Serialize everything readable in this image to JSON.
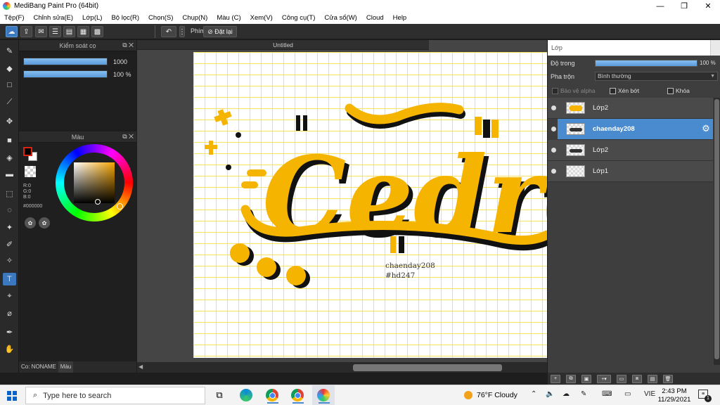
{
  "window": {
    "title": "MediBang Paint Pro (64bit)",
    "controls": {
      "minimize": "—",
      "maximize": "❐",
      "close": "✕"
    }
  },
  "menu": {
    "items": [
      "Tệp(F)",
      "Chỉnh sửa(E)",
      "Lớp(L)",
      "Bộ lọc(R)",
      "Chọn(S)",
      "Chụp(N)",
      "Màu (C)",
      "Xem(V)",
      "Công cụ(T)",
      "Cửa sổ(W)",
      "Cloud",
      "Help"
    ]
  },
  "toolbar": {
    "phim_label": "Phím",
    "reset_label": "Đặt lại"
  },
  "brush_panel": {
    "title": "Kiểm soát cọ",
    "size_value": "1000",
    "opacity_value": "100 %"
  },
  "color_panel": {
    "title": "Màu",
    "r": "R:0",
    "g": "G:0",
    "b": "B:0",
    "hex": "#000000",
    "accent": "#f5a400"
  },
  "bottom_tabs": {
    "brush_tab": "Co: NONAME",
    "color_tab": "Màu"
  },
  "canvas": {
    "doc_title": "Untitled",
    "signature_line1": "chaenday208",
    "signature_line2": "#hd247",
    "artwork_text": "Cedro"
  },
  "layer_panel": {
    "title": "Lớp",
    "opacity_label": "Độ trong",
    "opacity_value": "100 %",
    "blend_label": "Pha trộn",
    "blend_value": "Bình thường",
    "protect_alpha": "Bảo vệ alpha",
    "clipping": "Xén bớt",
    "lock": "Khóa",
    "layers": [
      {
        "name": "Lớp2",
        "selected": false
      },
      {
        "name": "chaenday208",
        "selected": true
      },
      {
        "name": "Lớp2",
        "selected": false
      },
      {
        "name": "Lớp1",
        "selected": false
      }
    ]
  },
  "taskbar": {
    "search_placeholder": "Type here to search",
    "weather_temp": "76°F",
    "weather_text": "Cloudy",
    "lang": "VIE",
    "time": "2:43 PM",
    "date": "11/29/2021",
    "notification_count": "1"
  }
}
